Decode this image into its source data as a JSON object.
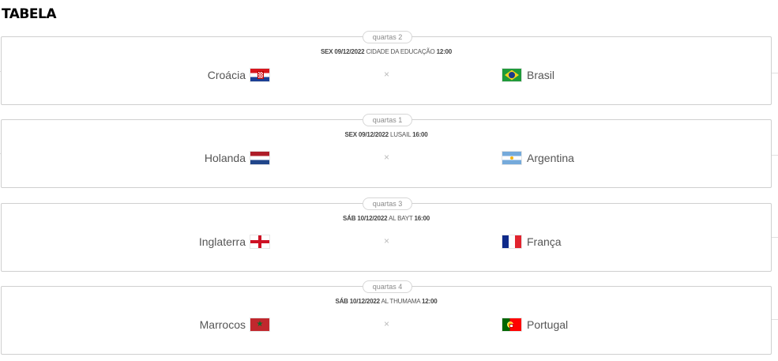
{
  "page": {
    "title": "TABELA"
  },
  "versus_symbol": "×",
  "matches": [
    {
      "round": "quartas 2",
      "day": "SEX",
      "date": "09/12/2022",
      "venue": "CIDADE DA EDUCAÇÃO",
      "time": "12:00",
      "home": {
        "name": "Croácia",
        "flag_icon": "croatia-flag-icon"
      },
      "away": {
        "name": "Brasil",
        "flag_icon": "brazil-flag-icon"
      }
    },
    {
      "round": "quartas 1",
      "day": "SEX",
      "date": "09/12/2022",
      "venue": "LUSAIL",
      "time": "16:00",
      "home": {
        "name": "Holanda",
        "flag_icon": "netherlands-flag-icon"
      },
      "away": {
        "name": "Argentina",
        "flag_icon": "argentina-flag-icon"
      }
    },
    {
      "round": "quartas 3",
      "day": "SÁB",
      "date": "10/12/2022",
      "venue": "AL BAYT",
      "time": "16:00",
      "home": {
        "name": "Inglaterra",
        "flag_icon": "england-flag-icon"
      },
      "away": {
        "name": "França",
        "flag_icon": "france-flag-icon"
      }
    },
    {
      "round": "quartas 4",
      "day": "SÁB",
      "date": "10/12/2022",
      "venue": "AL THUMAMA",
      "time": "12:00",
      "home": {
        "name": "Marrocos",
        "flag_icon": "morocco-flag-icon"
      },
      "away": {
        "name": "Portugal",
        "flag_icon": "portugal-flag-icon"
      }
    }
  ]
}
